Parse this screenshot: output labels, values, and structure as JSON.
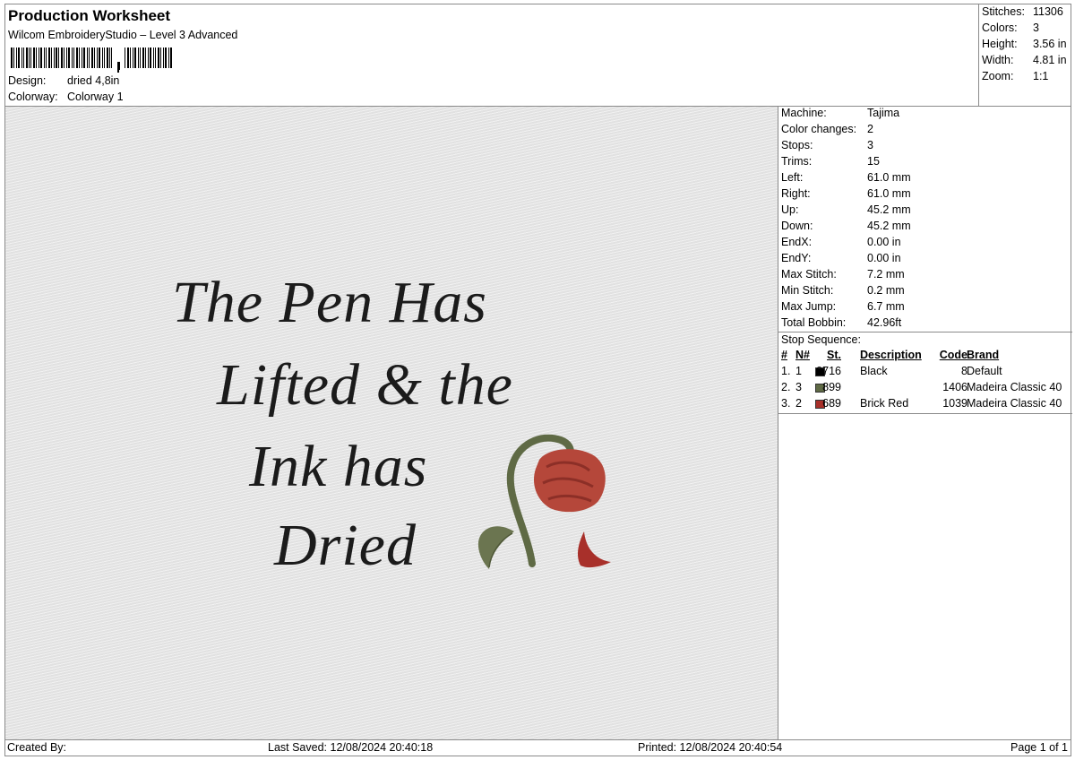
{
  "header": {
    "title": "Production Worksheet",
    "subtitle": "Wilcom EmbroideryStudio – Level 3 Advanced",
    "design_label": "Design:",
    "design_value": "dried 4,8in",
    "colorway_label": "Colorway:",
    "colorway_value": "Colorway 1"
  },
  "summary": [
    {
      "label": "Stitches:",
      "value": "11306"
    },
    {
      "label": "Colors:",
      "value": "3"
    },
    {
      "label": "Height:",
      "value": "3.56 in"
    },
    {
      "label": "Width:",
      "value": "4.81 in"
    },
    {
      "label": "Zoom:",
      "value": "1:1"
    }
  ],
  "design": {
    "lines": [
      "The Pen Has",
      "Lifted & the",
      "Ink has",
      "Dried"
    ],
    "colors": {
      "text": "#1b1b1b",
      "stem": "#5f6a45",
      "rose": "#b5473a",
      "rose_dark": "#8c2f27"
    }
  },
  "details": [
    {
      "label": "Machine:",
      "value": "Tajima"
    },
    {
      "label": "Color changes:",
      "value": "2"
    },
    {
      "label": "Stops:",
      "value": "3"
    },
    {
      "label": "Trims:",
      "value": "15"
    },
    {
      "label": "Left:",
      "value": "61.0 mm"
    },
    {
      "label": "Right:",
      "value": "61.0 mm"
    },
    {
      "label": "Up:",
      "value": "45.2 mm"
    },
    {
      "label": "Down:",
      "value": "45.2 mm"
    },
    {
      "label": "EndX:",
      "value": "0.00 in"
    },
    {
      "label": "EndY:",
      "value": "0.00 in"
    },
    {
      "label": "Max Stitch:",
      "value": "7.2 mm"
    },
    {
      "label": "Min Stitch:",
      "value": "0.2 mm"
    },
    {
      "label": "Max Jump:",
      "value": "6.7 mm"
    },
    {
      "label": "Total Bobbin:",
      "value": "42.96ft"
    }
  ],
  "stop_sequence": {
    "label": "Stop Sequence:",
    "headers": {
      "idx": "#",
      "n": "N#",
      "st": "St.",
      "desc": "Description",
      "code": "Code",
      "brand": "Brand"
    },
    "rows": [
      {
        "idx": "1.",
        "n": "1",
        "color": "#000000",
        "st": "9716",
        "desc": "Black",
        "code": "8",
        "brand": "Default"
      },
      {
        "idx": "2.",
        "n": "3",
        "color": "#5f6a45",
        "st": "899",
        "desc": "",
        "code": "1406",
        "brand": "Madeira Classic 40"
      },
      {
        "idx": "3.",
        "n": "2",
        "color": "#a8302a",
        "st": "689",
        "desc": "Brick Red",
        "code": "1039",
        "brand": "Madeira Classic 40"
      }
    ]
  },
  "footer": {
    "created_by": "Created By:",
    "last_saved": "Last Saved: 12/08/2024 20:40:18",
    "printed": "Printed: 12/08/2024 20:40:54",
    "page": "Page 1 of 1"
  }
}
